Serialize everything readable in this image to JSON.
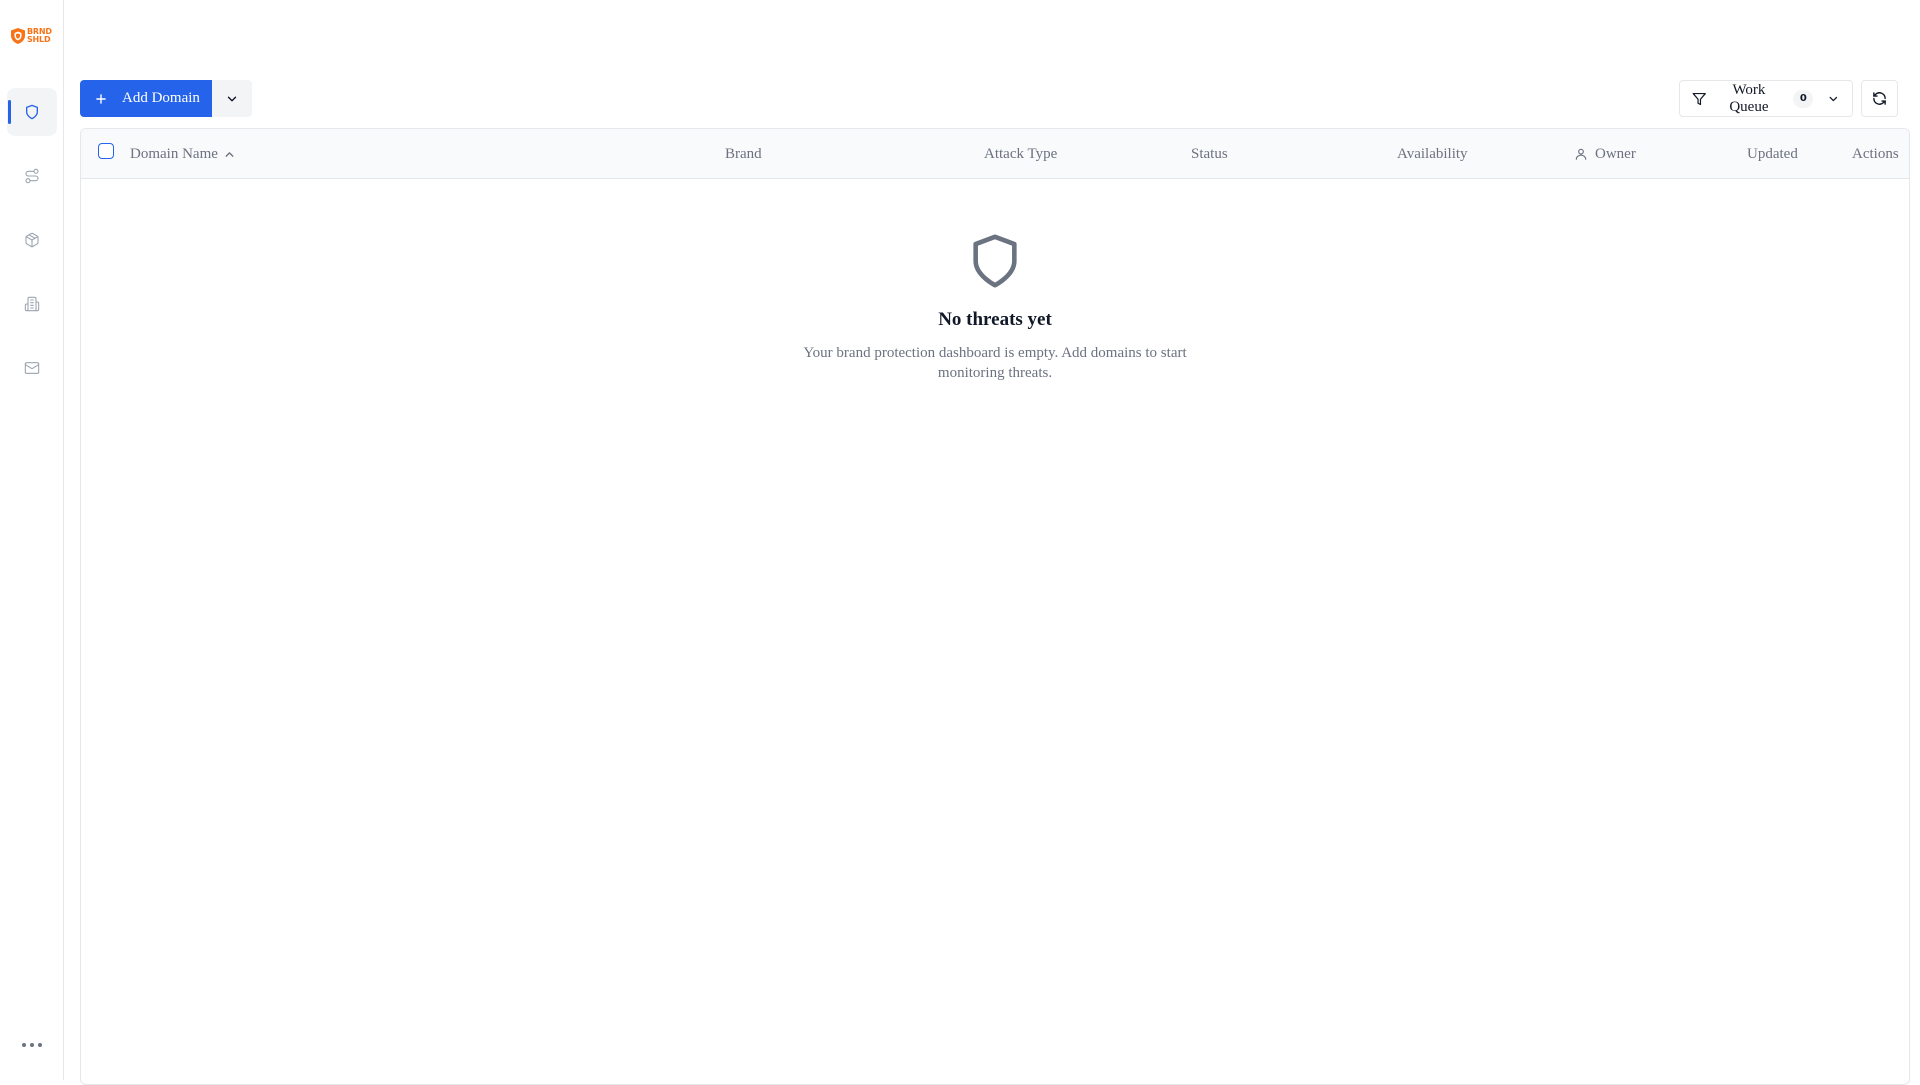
{
  "sidebar": {
    "logo_lines": [
      "BRND",
      "SHLD"
    ],
    "items": [
      {
        "icon": "shield-icon",
        "active": true
      },
      {
        "icon": "route-icon",
        "active": false
      },
      {
        "icon": "package-icon",
        "active": false
      },
      {
        "icon": "building-icon",
        "active": false
      },
      {
        "icon": "mail-icon",
        "active": false
      }
    ],
    "more_icon": "more-horizontal-icon"
  },
  "toolbar": {
    "add_label": "Add Domain",
    "work_queue_label": "Work Queue",
    "work_queue_count": "0"
  },
  "table": {
    "columns": {
      "domain": "Domain Name",
      "brand": "Brand",
      "attack_type": "Attack Type",
      "status": "Status",
      "availability": "Availability",
      "owner": "Owner",
      "updated": "Updated",
      "actions": "Actions"
    },
    "sort_column": "Domain Name",
    "sort_direction": "ascending",
    "rows": []
  },
  "empty_state": {
    "icon": "shield-icon",
    "title": "No threats yet",
    "description": "Your brand protection dashboard is empty. Add domains to start monitoring threats."
  },
  "colors": {
    "accent": "#2563eb",
    "brand": "#f97316",
    "muted_text": "#6b7280",
    "border": "#e5e7eb"
  }
}
